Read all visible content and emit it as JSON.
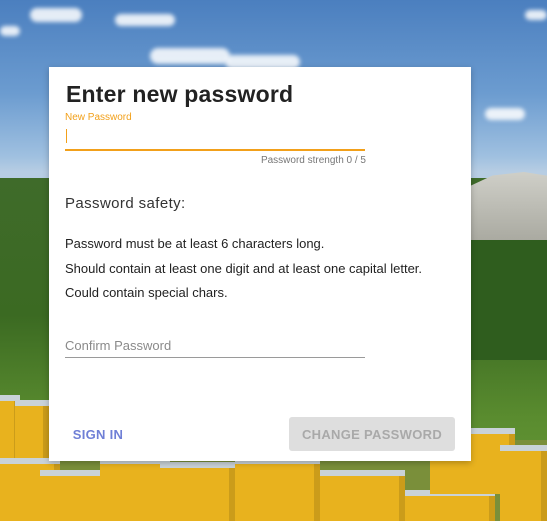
{
  "form": {
    "title": "Enter new password",
    "new_password_label": "New Password",
    "new_password_value": "",
    "strength_text": "Password strength 0 / 5",
    "safety_title": "Password safety:",
    "rules": [
      "Password must be at least 6 characters long.",
      "Should contain at least one digit and at least one capital letter.",
      "Could contain special chars."
    ],
    "confirm_placeholder": "Confirm Password",
    "confirm_value": ""
  },
  "actions": {
    "sign_in_label": "SIGN IN",
    "change_password_label": "CHANGE PASSWORD"
  },
  "colors": {
    "accent": "#f2a01a",
    "link": "#6f7fd6",
    "disabled_bg": "#dedede",
    "disabled_text": "#a9a9a9"
  }
}
